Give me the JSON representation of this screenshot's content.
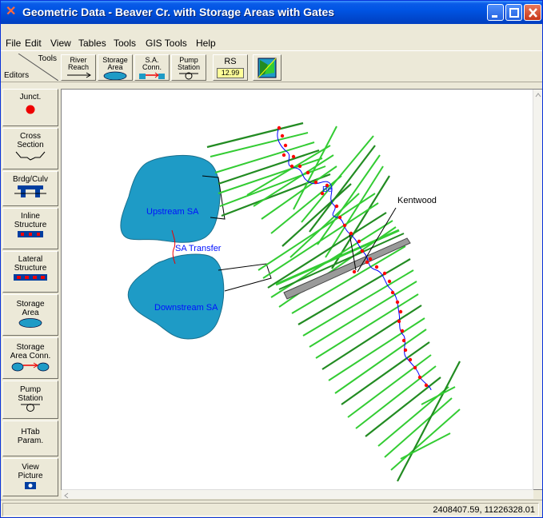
{
  "window": {
    "title": "Geometric Data - Beaver Cr. with Storage Areas with Gates"
  },
  "menu": {
    "items": [
      "File",
      "Edit",
      "View",
      "Tables",
      "Tools",
      "GIS Tools",
      "Help"
    ]
  },
  "toolbar": {
    "corner_tools": "Tools",
    "corner_editors": "Editors",
    "river_reach": [
      "River",
      "Reach"
    ],
    "storage_area": [
      "Storage",
      "Area"
    ],
    "sa_conn": [
      "S.A.",
      "Conn."
    ],
    "pump_station": [
      "Pump",
      "Station"
    ],
    "rs_label": "RS",
    "rs_value": "12.99"
  },
  "sidebar": {
    "items": [
      {
        "lines": [
          "Junct."
        ]
      },
      {
        "lines": [
          "Cross",
          "Section"
        ]
      },
      {
        "lines": [
          "Brdg/Culv"
        ]
      },
      {
        "lines": [
          "Inline",
          "Structure"
        ]
      },
      {
        "lines": [
          "Lateral",
          "Structure"
        ]
      },
      {
        "lines": [
          "Storage",
          "Area"
        ]
      },
      {
        "lines": [
          "Storage",
          "Area Conn."
        ]
      },
      {
        "lines": [
          "Pump",
          "Station"
        ]
      },
      {
        "lines": [
          "HTab",
          "Param."
        ]
      },
      {
        "lines": [
          "View",
          "Picture"
        ]
      }
    ]
  },
  "map": {
    "upstream_label": "Upstream SA",
    "downstream_label": "Downstream SA",
    "transfer_label": "SA Transfer",
    "town_label": "Kentwood",
    "river_label": "Be"
  },
  "status": {
    "coords": "2408407.59, 11226328.01"
  },
  "colors": {
    "storage_area": "#1e9bc6",
    "xs_light": "#33cc33",
    "xs_dark": "#228b22",
    "river": "#0000ff",
    "points": "#ff0000"
  }
}
